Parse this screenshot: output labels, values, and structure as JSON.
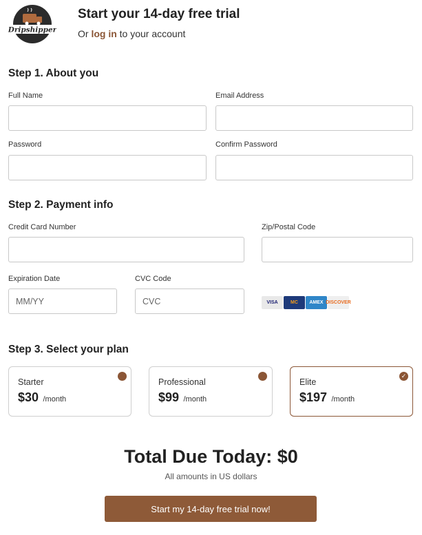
{
  "brand": {
    "name": "Dripshipper",
    "color": "#8b5636"
  },
  "header": {
    "title": "Start your 14-day free trial",
    "subtitle_prefix": "Or",
    "login_link": "log in",
    "subtitle_suffix": "to your account"
  },
  "step1": {
    "heading": "Step 1. About you",
    "full_name_label": "Full Name",
    "full_name_value": "",
    "email_label": "Email Address",
    "email_value": "",
    "password_label": "Password",
    "password_value": "",
    "confirm_password_label": "Confirm Password",
    "confirm_password_value": ""
  },
  "step2": {
    "heading": "Step 2. Payment info",
    "card_number_label": "Credit Card Number",
    "card_number_value": "",
    "zip_label": "Zip/Postal Code",
    "zip_value": "",
    "expiration_label": "Expiration Date",
    "expiration_placeholder": "MM/YY",
    "cvc_label": "CVC Code",
    "cvc_placeholder": "CVC",
    "card_brands": [
      {
        "name": "VISA",
        "icon": "visa-card-icon",
        "bg": "#e9e9e9",
        "fg": "#1a1f71"
      },
      {
        "name": "MC",
        "icon": "mastercard-icon",
        "bg": "#1e3a7a",
        "fg": "#f79e1b"
      },
      {
        "name": "AMEX",
        "icon": "amex-card-icon",
        "bg": "#2f86c8",
        "fg": "#ffffff"
      },
      {
        "name": "DISCOVER",
        "icon": "discover-card-icon",
        "bg": "#efefef",
        "fg": "#e86b1f"
      }
    ]
  },
  "step3": {
    "heading": "Step 3. Select your plan",
    "plans": [
      {
        "name": "Starter",
        "price": "$30",
        "period": "/month",
        "selected": false
      },
      {
        "name": "Professional",
        "price": "$99",
        "period": "/month",
        "selected": false
      },
      {
        "name": "Elite",
        "price": "$197",
        "period": "/month",
        "selected": true
      }
    ]
  },
  "summary": {
    "total": "Total Due Today: $0",
    "note": "All amounts in US dollars",
    "cta_label": "Start my 14-day free trial now!"
  }
}
